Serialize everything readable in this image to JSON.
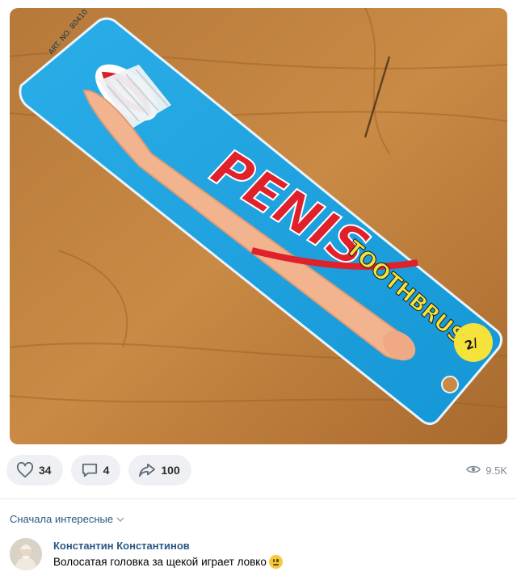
{
  "post": {
    "image": {
      "package_brand": "PENIS",
      "package_product": "TOOTHBRUSH",
      "badge_text": "2/",
      "small_print": "ART. NO. 80410"
    },
    "actions": {
      "likes": "34",
      "comments": "4",
      "shares": "100",
      "views": "9.5K"
    }
  },
  "comments": {
    "sort_label": "Сначала интересные",
    "items": [
      {
        "author": "Константин Константинов",
        "text": "Волосатая головка за щекой играет ловко"
      }
    ]
  },
  "colors": {
    "link": "#2a5885",
    "package_blue": "#1aa0e0",
    "brand_red": "#e0202a",
    "pill_bg": "#eef0f3"
  }
}
